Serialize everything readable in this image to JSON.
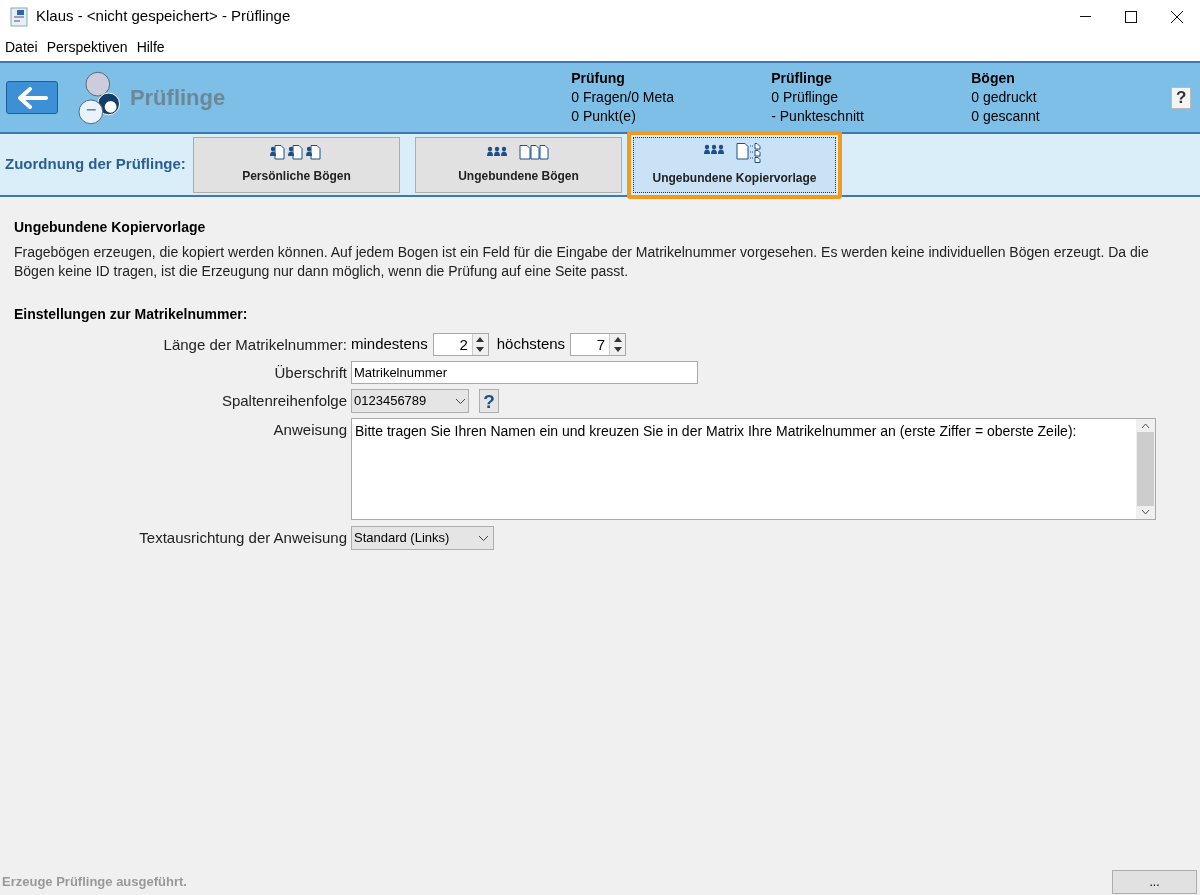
{
  "window": {
    "title": "Klaus - <nicht gespeichert> - Prüflinge"
  },
  "menu": [
    "Datei",
    "Perspektiven",
    "Hilfe"
  ],
  "header": {
    "title": "Prüflinge",
    "help": "?",
    "stats": [
      {
        "title": "Prüfung",
        "lines": [
          "0 Fragen/0 Meta",
          "0 Punkt(e)"
        ]
      },
      {
        "title": "Prüflinge",
        "lines": [
          "0 Prüflinge",
          "- Punkteschnitt"
        ]
      },
      {
        "title": "Bögen",
        "lines": [
          "0 gedruckt",
          "0 gescannt"
        ]
      }
    ]
  },
  "assignment": {
    "label": "Zuordnung der Prüflinge:",
    "tabs": [
      {
        "label": "Persönliche Bögen",
        "kind": "personal",
        "selected": false
      },
      {
        "label": "Ungebundene Bögen",
        "kind": "unbound",
        "selected": false
      },
      {
        "label": "Ungebundene Kopiervorlage",
        "kind": "template",
        "selected": true
      }
    ]
  },
  "section": {
    "title": "Ungebundene Kopiervorlage",
    "description": "Fragebögen erzeugen, die kopiert werden können. Auf jedem Bogen ist ein Feld für die Eingabe der Matrikelnummer vorgesehen. Es werden keine individuellen Bögen erzeugt. Da die Bögen keine ID tragen, ist die Erzeugung nur dann möglich, wenn die Prüfung auf eine Seite passt."
  },
  "settings": {
    "title": "Einstellungen zur Matrikelnummer:",
    "length": {
      "label": "Länge der Matrikelnummer:",
      "min_label": "mindestens",
      "min": "2",
      "max_label": "höchstens",
      "max": "7"
    },
    "heading": {
      "label": "Überschrift",
      "value": "Matrikelnummer"
    },
    "column_order": {
      "label": "Spaltenreihenfolge",
      "value": "0123456789",
      "help": "?"
    },
    "instruction": {
      "label": "Anweisung",
      "value": "Bitte tragen Sie Ihren Namen ein und kreuzen Sie in der Matrix Ihre Matrikelnummer an (erste Ziffer = oberste Zeile):"
    },
    "alignment": {
      "label": "Textausrichtung der Anweisung",
      "value": "Standard (Links)"
    }
  },
  "status_bar": {
    "message": "Erzeuge Prüflinge ausgeführt.",
    "button": "..."
  }
}
